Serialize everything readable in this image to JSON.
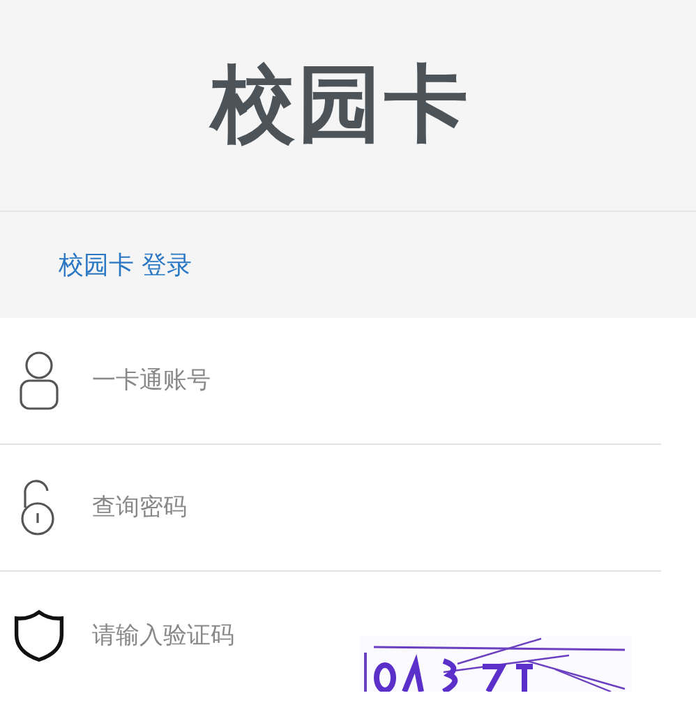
{
  "header": {
    "title": "校园卡"
  },
  "tabs": [
    {
      "label": "校园卡 登录",
      "selected": true
    }
  ],
  "fields": [
    {
      "kind": "account",
      "placeholder": "一卡通账号"
    },
    {
      "kind": "password",
      "placeholder": "查询密码"
    },
    {
      "kind": "captcha",
      "placeholder": "请输入验证码"
    }
  ]
}
